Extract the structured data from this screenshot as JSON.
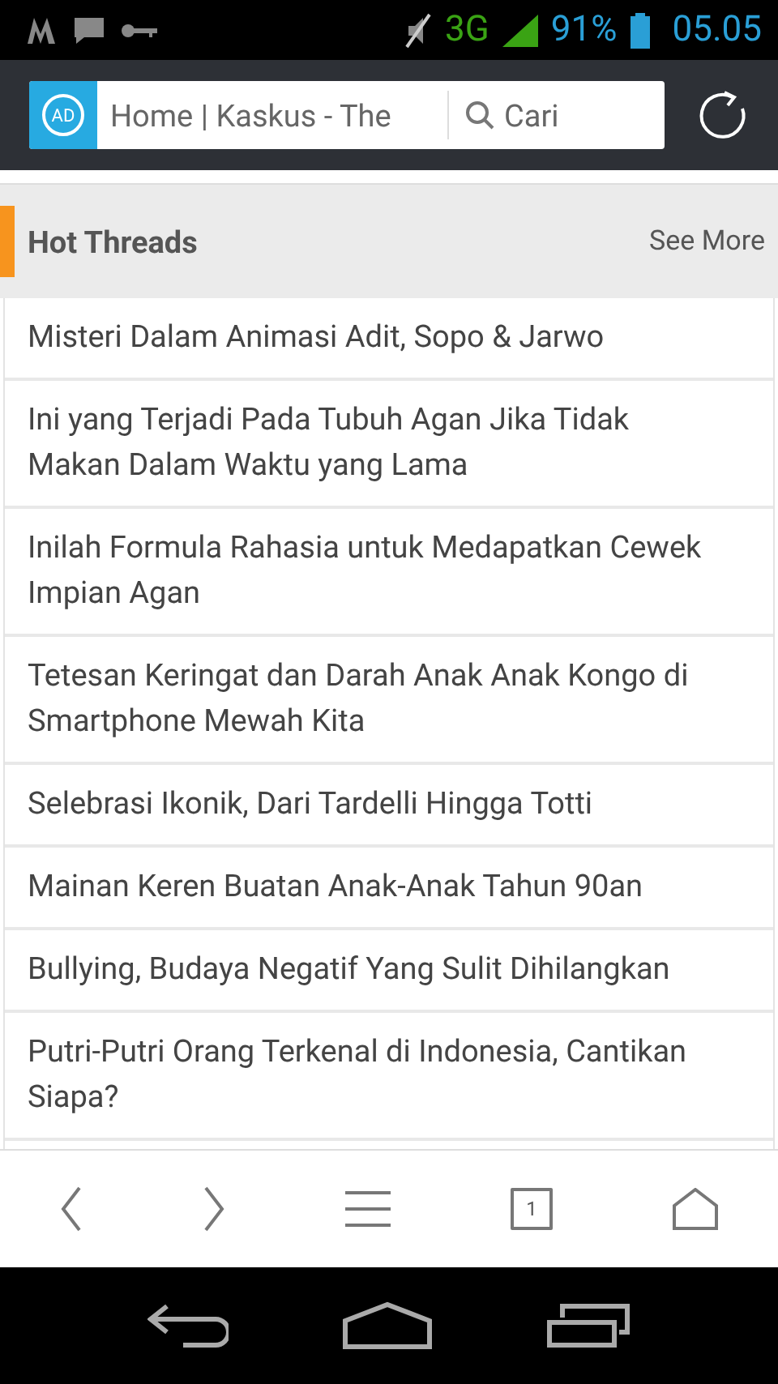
{
  "status_bar": {
    "network": "3G",
    "battery": "91%",
    "time": "05.05"
  },
  "address_bar": {
    "ad_badge": "AD",
    "page_title": "Home | Kaskus - The",
    "search_placeholder": "Cari"
  },
  "section": {
    "title": "Hot Threads",
    "link": "See More"
  },
  "threads": [
    "Misteri Dalam Animasi Adit, Sopo & Jarwo",
    "Ini yang Terjadi Pada Tubuh Agan Jika Tidak Makan Dalam Waktu yang Lama",
    "Inilah Formula Rahasia untuk Medapatkan Cewek Impian Agan",
    "Tetesan Keringat dan Darah Anak Anak Kongo di Smartphone Mewah Kita",
    "Selebrasi Ikonik, Dari Tardelli Hingga Totti",
    "Mainan Keren Buatan Anak-Anak Tahun 90an",
    "Bullying, Budaya Negatif Yang Sulit Dihilangkan",
    "Putri-Putri Orang Terkenal di Indonesia, Cantikan Siapa?"
  ],
  "bottom_toolbar": {
    "tab_count": "1"
  }
}
